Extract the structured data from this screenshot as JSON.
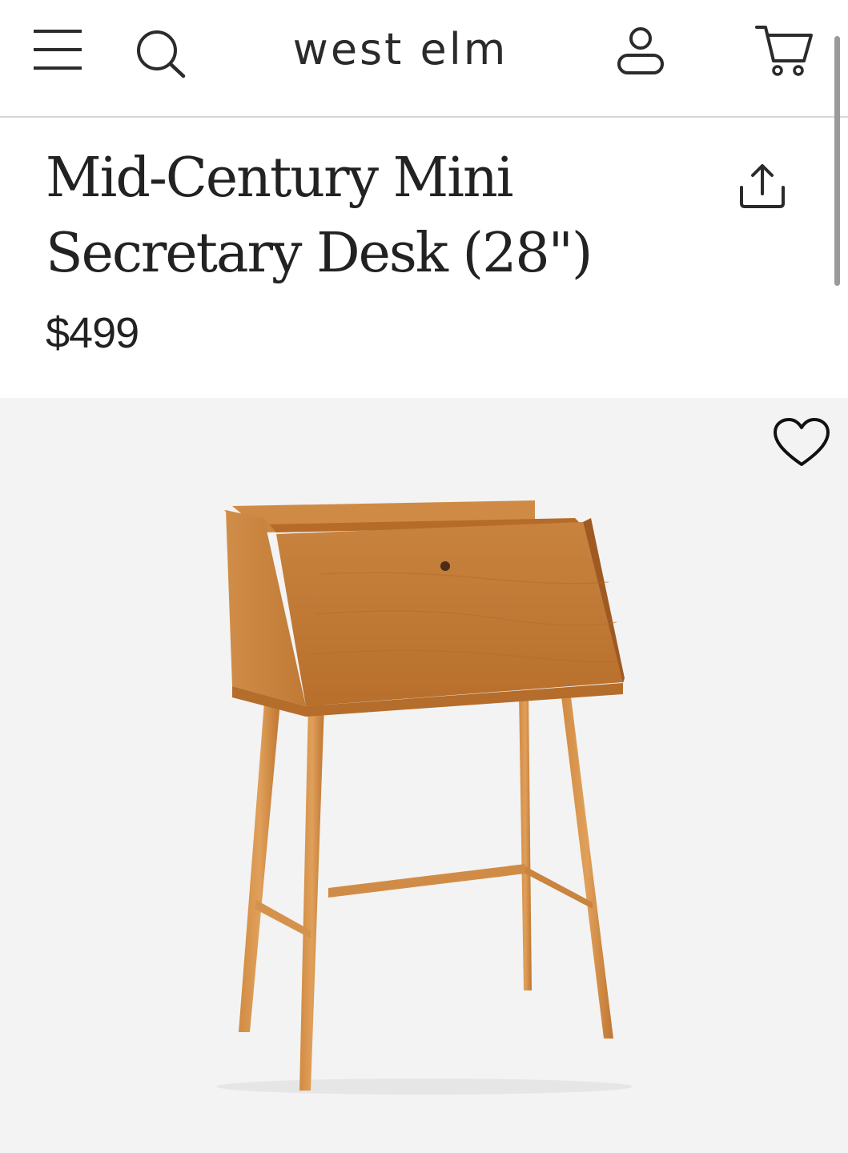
{
  "header": {
    "brand": "west elm",
    "icons": {
      "menu": "hamburger-menu-icon",
      "search": "search-icon",
      "account": "user-icon",
      "cart": "shopping-cart-icon"
    }
  },
  "product": {
    "title": "Mid-Century Mini Secretary Desk (28\")",
    "price": "$499",
    "share_icon": "share-icon",
    "favorite_icon": "heart-icon"
  },
  "colors": {
    "text": "#222222",
    "divider": "#d8d8d8",
    "hero_background": "#f3f3f3",
    "wood": "#c27a35"
  }
}
